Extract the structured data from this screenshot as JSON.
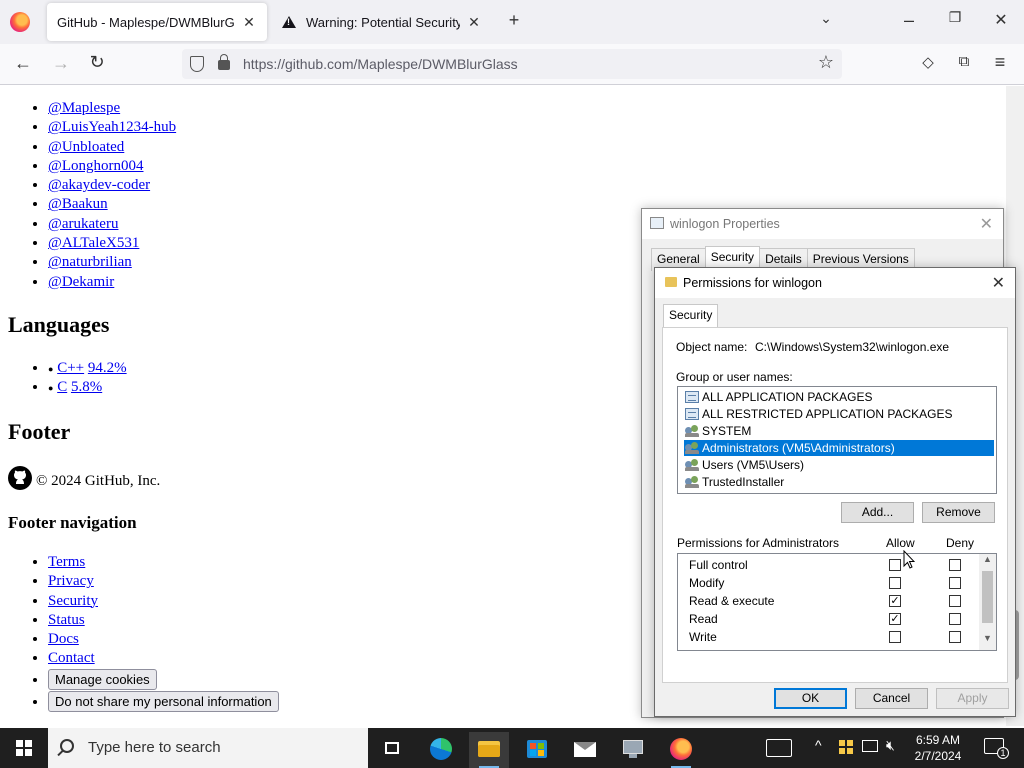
{
  "browser": {
    "tabs": [
      {
        "label": "GitHub - Maplespe/DWMBlurGlass",
        "active": true
      },
      {
        "label": "Warning: Potential Security Risk",
        "active": false
      }
    ],
    "new_tab_symbol": "+",
    "url": "https://github.com/Maplespe/DWMBlurGlass",
    "icons": [
      "firefox-logo",
      "back-arrow",
      "forward-arrow",
      "reload",
      "shield",
      "lock",
      "bookmark-star",
      "pocket",
      "extensions",
      "menu",
      "list-all-tabs",
      "minimize",
      "restore",
      "close"
    ]
  },
  "page": {
    "contributors": [
      "@Maplespe",
      "@LuisYeah1234-hub",
      "@Unbloated",
      "@Longhorn004",
      "@akaydev-coder",
      "@Baakun",
      "@arukateru",
      "@ALTaleX531",
      "@naturbrilian",
      "@Dekamir"
    ],
    "languages_heading": "Languages",
    "languages": [
      {
        "name": "C++",
        "percent": "94.2%"
      },
      {
        "name": "C",
        "percent": "5.8%"
      }
    ],
    "footer_heading": "Footer",
    "copyright": "© 2024 GitHub, Inc.",
    "footer_nav_heading": "Footer navigation",
    "footer_links": [
      "Terms",
      "Privacy",
      "Security",
      "Status",
      "Docs",
      "Contact"
    ],
    "manage_cookies": "Manage cookies",
    "do_not_share": "Do not share my personal information"
  },
  "properties_dialog": {
    "title": "winlogon Properties",
    "tabs": [
      "General",
      "Security",
      "Details",
      "Previous Versions"
    ],
    "active_tab": "Security"
  },
  "permissions_dialog": {
    "title": "Permissions for winlogon",
    "tab": "Security",
    "object_name_label": "Object name:",
    "object_name": "C:\\Windows\\System32\\winlogon.exe",
    "group_label": "Group or user names:",
    "groups": [
      {
        "name": "ALL APPLICATION PACKAGES",
        "icon": "package-icon",
        "selected": false
      },
      {
        "name": "ALL RESTRICTED APPLICATION PACKAGES",
        "icon": "package-icon",
        "selected": false
      },
      {
        "name": "SYSTEM",
        "icon": "users-icon",
        "selected": false
      },
      {
        "name": "Administrators (VM5\\Administrators)",
        "icon": "users-icon",
        "selected": true
      },
      {
        "name": "Users (VM5\\Users)",
        "icon": "users-icon",
        "selected": false
      },
      {
        "name": "TrustedInstaller",
        "icon": "users-icon",
        "selected": false
      }
    ],
    "add_button": "Add...",
    "remove_button": "Remove",
    "permissions_for_label": "Permissions for Administrators",
    "allow_label": "Allow",
    "deny_label": "Deny",
    "permissions": [
      {
        "name": "Full control",
        "allow": false,
        "deny": false
      },
      {
        "name": "Modify",
        "allow": false,
        "deny": false
      },
      {
        "name": "Read & execute",
        "allow": true,
        "deny": false
      },
      {
        "name": "Read",
        "allow": true,
        "deny": false
      },
      {
        "name": "Write",
        "allow": false,
        "deny": false
      }
    ],
    "ok_button": "OK",
    "cancel_button": "Cancel",
    "apply_button": "Apply"
  },
  "taskbar": {
    "search_placeholder": "Type here to search",
    "apps": [
      "task-view",
      "edge",
      "file-explorer",
      "microsoft-store",
      "mail",
      "network-app",
      "firefox"
    ],
    "time": "6:59 AM",
    "date": "2/7/2024",
    "notification_count": "1"
  },
  "colors": {
    "selection": "#0078d7",
    "link": "#0000ee",
    "taskbar": "#1f1f1f"
  }
}
